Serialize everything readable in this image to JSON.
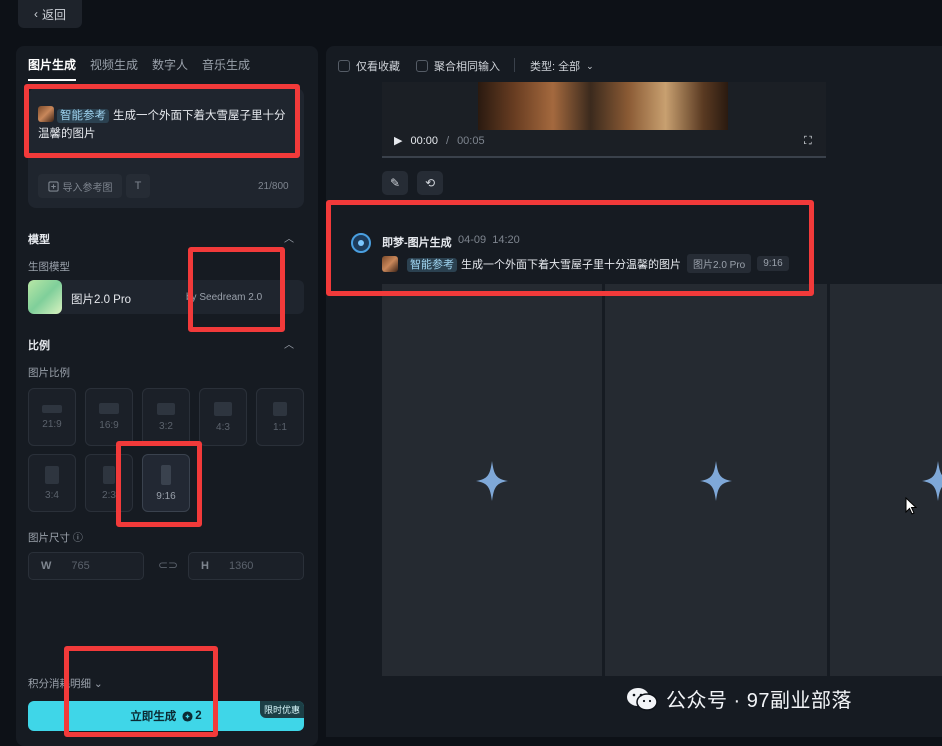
{
  "nav": {
    "back_label": "返回",
    "back_icon": "chevron-left-icon"
  },
  "tabs": [
    {
      "label": "图片生成",
      "active": true
    },
    {
      "label": "视频生成",
      "active": false
    },
    {
      "label": "数字人",
      "active": false
    },
    {
      "label": "音乐生成",
      "active": false
    }
  ],
  "prompt": {
    "tag": "智能参考",
    "text": "生成一个外面下着大雪屋子里十分温馨的图片",
    "import_ref_label": "导入参考图",
    "text_tool_label": "T",
    "char_count": "21/800"
  },
  "model": {
    "section_title": "模型",
    "sub_title": "生图模型",
    "name": "图片2.0 Pro",
    "provider": "by Seedream 2.0"
  },
  "ratio": {
    "section_title": "比例",
    "sub_title": "图片比例",
    "options": [
      "21:9",
      "16:9",
      "3:2",
      "4:3",
      "1:1",
      "3:4",
      "2:3",
      "9:16"
    ],
    "selected": "9:16"
  },
  "size": {
    "label": "图片尺寸",
    "width_key": "W",
    "width_value": "765",
    "height_key": "H",
    "height_value": "1360"
  },
  "footer": {
    "credits_label": "积分消耗明细",
    "generate_label": "立即生成",
    "credit_cost": "2",
    "promo_badge": "限时优惠"
  },
  "filters": {
    "favorites_label": "仅看收藏",
    "merge_label": "聚合相同输入",
    "type_label": "类型: 全部"
  },
  "video": {
    "current_time": "00:00",
    "separator": "/",
    "duration": "00:05"
  },
  "record": {
    "title": "即梦-图片生成",
    "date": "04-09",
    "time": "14:20",
    "prompt_tag": "智能参考",
    "prompt_text": "生成一个外面下着大雪屋子里十分温馨的图片",
    "model_pill": "图片2.0 Pro",
    "ratio_pill": "9:16"
  },
  "watermark": {
    "text": "公众号 · 97副业部落"
  },
  "colors": {
    "accent": "#3fd6e8",
    "highlight_box": "#f23a3a",
    "background": "#0d1117",
    "panel": "#161b22"
  }
}
